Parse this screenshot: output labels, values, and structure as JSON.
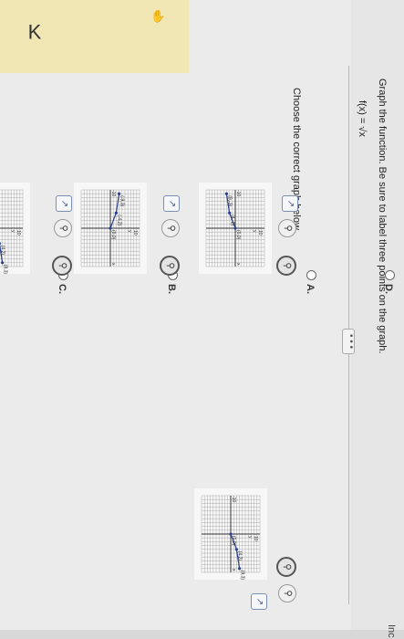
{
  "header": {
    "back_label": "K",
    "question": "Graph the function. Be sure to label three points on the graph.",
    "function": "f(x) = √x",
    "more_button": "• • •"
  },
  "prompt": "Choose the correct graph below.",
  "options": [
    {
      "id": "A",
      "label": "A.",
      "axis_max": "10",
      "axis_min": "-10",
      "x_label": "x",
      "y_label": "y",
      "points": [
        {
          "x": 0,
          "y": 0,
          "label": "(0,0)"
        },
        {
          "x": -4,
          "y": -2,
          "label": "(-4,-2)"
        },
        {
          "x": -9,
          "y": -3,
          "label": "(-9,-3)"
        }
      ],
      "point_labels": [
        "(0,0)",
        "(4,-2)",
        "(9,-3)"
      ]
    },
    {
      "id": "B",
      "label": "B.",
      "axis_max": "10",
      "axis_min": "-10",
      "x_label": "x",
      "y_label": "y",
      "points": [
        {
          "x": 0,
          "y": 0,
          "label": "(0,0)"
        },
        {
          "x": -4,
          "y": 2,
          "label": "(-4,2)"
        },
        {
          "x": -9,
          "y": 3,
          "label": "(-9,3)"
        }
      ],
      "point_labels": [
        "(0,0)",
        "(-4,2)",
        "(-9,3)"
      ]
    },
    {
      "id": "C",
      "label": "C.",
      "axis_max": "10",
      "axis_min": "-10",
      "x_label": "x",
      "y_label": "y",
      "points": [
        {
          "x": 0,
          "y": 0,
          "label": "(0,0)"
        },
        {
          "x": 4,
          "y": 2,
          "label": "(4,2)"
        },
        {
          "x": 9,
          "y": 3,
          "label": "(9,3)"
        }
      ],
      "point_labels": [
        "(0,0)",
        "(4,2)",
        "(9,3)"
      ]
    },
    {
      "id": "D",
      "label": "D.",
      "axis_max": "10",
      "axis_min": "-10",
      "x_label": "x",
      "y_label": "y",
      "points": [
        {
          "x": 0,
          "y": 0,
          "label": "(0,0)"
        },
        {
          "x": 4,
          "y": 2,
          "label": "(4,2)"
        },
        {
          "x": 9,
          "y": 3,
          "label": "(9,3)"
        }
      ],
      "point_labels": [
        "(0,0)",
        "(4,2)",
        "(9,3)"
      ]
    }
  ],
  "edge_text": "Inc",
  "colors": {
    "curve": "#2b3f8f",
    "grid": "#9a9a9a",
    "axis": "#333333"
  }
}
